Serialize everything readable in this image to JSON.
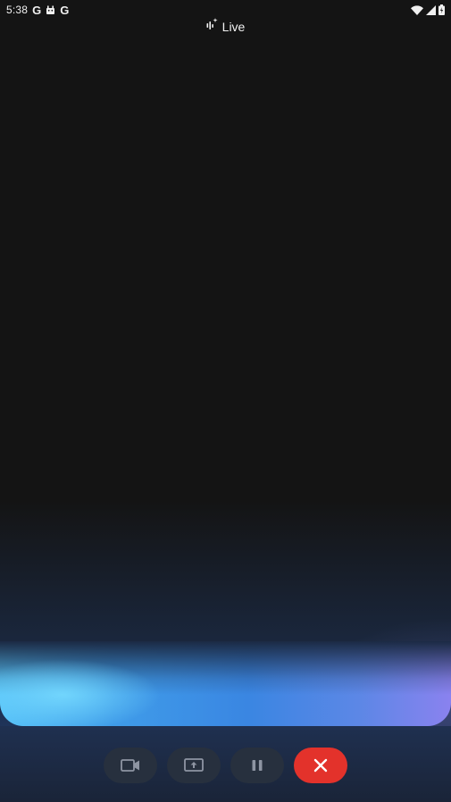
{
  "status_bar": {
    "time": "5:38",
    "notification_icons": [
      "google-g-icon",
      "android-icon",
      "google-g-icon"
    ],
    "google_glyph": "G",
    "system_icons": [
      "wifi-icon",
      "cell-signal-icon",
      "battery-icon"
    ]
  },
  "header": {
    "icon": "live-sparkle-icon",
    "label": "Live"
  },
  "controls": {
    "buttons": [
      {
        "name": "camera",
        "icon": "video-camera-icon"
      },
      {
        "name": "share-screen",
        "icon": "screen-share-icon"
      },
      {
        "name": "pause",
        "icon": "pause-icon"
      },
      {
        "name": "end-session",
        "icon": "close-icon",
        "color": "#e3322b"
      }
    ]
  },
  "colors": {
    "background": "#141414",
    "glow_light_blue": "#58c3f8",
    "glow_blue": "#3a86e2",
    "glow_violet": "#8a82ef",
    "end_button": "#e3322b"
  }
}
